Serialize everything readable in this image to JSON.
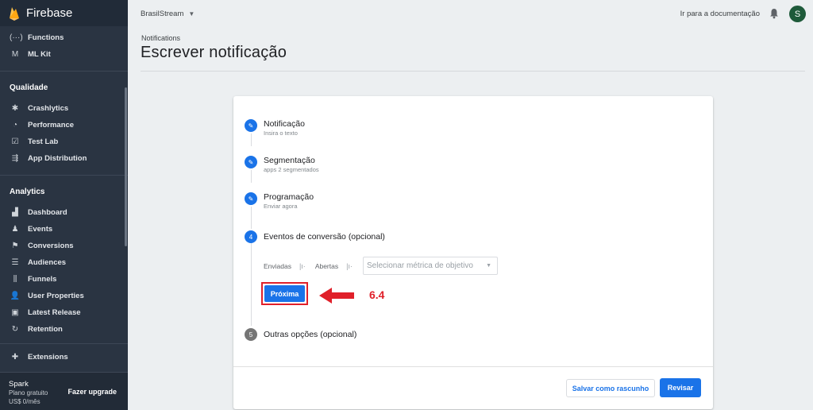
{
  "app": {
    "name": "Firebase"
  },
  "sidebar": {
    "top_items": [
      {
        "label": "Functions",
        "icon": "functions-icon",
        "glyph": "(···)"
      },
      {
        "label": "ML Kit",
        "icon": "ml-kit-icon",
        "glyph": "M"
      }
    ],
    "quality": {
      "heading": "Qualidade",
      "items": [
        {
          "label": "Crashlytics",
          "icon": "crashlytics-icon",
          "glyph": "✱"
        },
        {
          "label": "Performance",
          "icon": "performance-icon",
          "glyph": "◔"
        },
        {
          "label": "Test Lab",
          "icon": "test-lab-icon",
          "glyph": "☑"
        },
        {
          "label": "App Distribution",
          "icon": "app-distribution-icon",
          "glyph": "⇶"
        }
      ]
    },
    "analytics": {
      "heading": "Analytics",
      "items": [
        {
          "label": "Dashboard",
          "icon": "dashboard-icon",
          "glyph": "▟"
        },
        {
          "label": "Events",
          "icon": "events-icon",
          "glyph": "♟"
        },
        {
          "label": "Conversions",
          "icon": "conversions-icon",
          "glyph": "⚑"
        },
        {
          "label": "Audiences",
          "icon": "audiences-icon",
          "glyph": "☰"
        },
        {
          "label": "Funnels",
          "icon": "funnels-icon",
          "glyph": "⫼"
        },
        {
          "label": "User Properties",
          "icon": "user-properties-icon",
          "glyph": "👤"
        },
        {
          "label": "Latest Release",
          "icon": "latest-release-icon",
          "glyph": "▣"
        },
        {
          "label": "Retention",
          "icon": "retention-icon",
          "glyph": "↻"
        }
      ]
    },
    "extensions": {
      "label": "Extensions",
      "icon": "extensions-icon",
      "glyph": "✚"
    },
    "plan": {
      "name": "Spark",
      "line1": "Plano gratuito",
      "line2": "US$ 0/mês",
      "upgrade_label": "Fazer upgrade"
    }
  },
  "topbar": {
    "project_name": "BrasilStream",
    "doc_link": "Ir para a documentação",
    "avatar_letter": "S"
  },
  "page": {
    "breadcrumb": "Notifications",
    "title": "Escrever notificação"
  },
  "steps": [
    {
      "title": "Notificação",
      "subtitle": "Insira o texto",
      "status": "done"
    },
    {
      "title": "Segmentação",
      "subtitle": "apps 2 segmentados",
      "status": "done"
    },
    {
      "title": "Programação",
      "subtitle": "Enviar agora",
      "status": "done"
    },
    {
      "title": "Eventos de conversão (opcional)",
      "subtitle": "",
      "status": "active",
      "number": "4"
    },
    {
      "title": "Outras opções (opcional)",
      "subtitle": "",
      "status": "pending",
      "number": "5"
    }
  ],
  "conversion": {
    "sent_label": "Enviadas",
    "opened_label": "Abertas",
    "separator": "|ı·",
    "metric_placeholder": "Selecionar métrica de objetivo"
  },
  "buttons": {
    "next_label": "Próxima",
    "draft_label": "Salvar como rascunho",
    "review_label": "Revisar"
  },
  "annotation": {
    "label": "6.4",
    "color": "#e0202a"
  },
  "colors": {
    "accent": "#1a73e8",
    "sidebar_bg": "#2a3442",
    "annotation": "#e0202a"
  }
}
